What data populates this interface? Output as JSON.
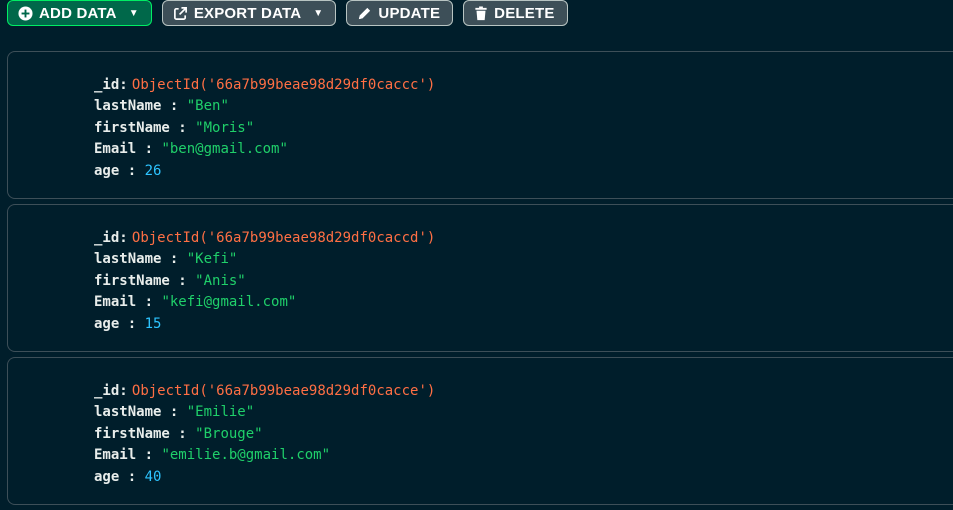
{
  "toolbar": {
    "add_label": "ADD DATA",
    "export_label": "EXPORT DATA",
    "update_label": "UPDATE",
    "delete_label": "DELETE"
  },
  "documents": [
    {
      "id_key": "_id:",
      "id_value": "ObjectId('66a7b99beae98d29df0caccc')",
      "lastName_key": "lastName",
      "lastName_value": "\"Ben\"",
      "firstName_key": "firstName",
      "firstName_value": "\"Moris\"",
      "email_key": "Email",
      "email_value": "\"ben@gmail.com\"",
      "age_key": "age",
      "age_value": "26"
    },
    {
      "id_key": "_id:",
      "id_value": "ObjectId('66a7b99beae98d29df0caccd')",
      "lastName_key": "lastName",
      "lastName_value": "\"Kefi\"",
      "firstName_key": "firstName",
      "firstName_value": "\"Anis\"",
      "email_key": "Email",
      "email_value": "\"kefi@gmail.com\"",
      "age_key": "age",
      "age_value": "15"
    },
    {
      "id_key": "_id:",
      "id_value": "ObjectId('66a7b99beae98d29df0cacce')",
      "lastName_key": "lastName",
      "lastName_value": "\"Emilie\"",
      "firstName_key": "firstName",
      "firstName_value": "\"Brouge\"",
      "email_key": "Email",
      "email_value": "\"emilie.b@gmail.com\"",
      "age_key": "age",
      "age_value": "40"
    }
  ],
  "colors": {
    "background": "#001e2b",
    "objectid": "#ff6f44",
    "string": "#1fd06a",
    "number": "#2dc4ff",
    "primary_button": "#00684a",
    "primary_border": "#00ed64"
  }
}
